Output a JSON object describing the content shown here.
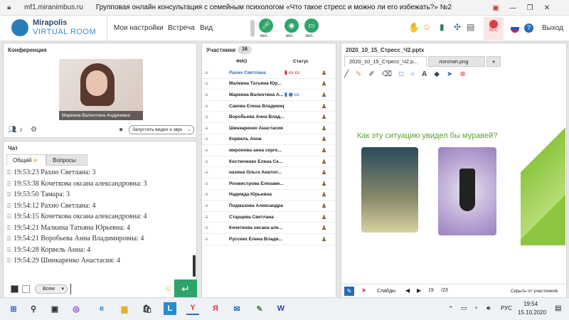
{
  "window": {
    "url": "mf1.miranimbus.ru",
    "title": "Групповая онлайн консультация с семейным психологом «Что такое стресс и можно ли его избежать?» №2"
  },
  "app": {
    "logo_line1": "Mirapolis",
    "logo_line2": "VIRTUAL ROOM",
    "menu": [
      "Мои настройки",
      "Встреча",
      "Вид"
    ],
    "mic_label": "вкл.",
    "cam_label": "вкл.",
    "screen_label": "вкл.",
    "rec_label": "REC",
    "exit_label": "Выход",
    "colors": {
      "accent": "#2da56a",
      "rec": "#e03a3a",
      "header_blue": "#2a7db8"
    }
  },
  "conference": {
    "title": "Конференция",
    "video_caption": "Маркина Валентина  Андреевна",
    "start_video_label": "Запустить видео и звук"
  },
  "chat": {
    "title": "Чат",
    "tabs": [
      "Общий",
      "Вопросы"
    ],
    "messages": [
      "19:53:23 Рахно Светлана: 3",
      "19:53:38 Кочеткова  оксана александровна: 3",
      "19:53:50 Тамара: 3",
      "19:54:12 Рахно Светлана: 4",
      "19:54:15 Кочеткова  оксана александровна: 4",
      "19:54:21 Малкина Татьяна  Юрьевна: 4",
      "19:54:21 Воробьева Анна  Владимировна: 4",
      "19:54:28 Корвель Анна: 4",
      "19:54:29 Шинкаренко  Анастасия: 4"
    ],
    "recipient": "Всем",
    "send_icon": "enter-icon"
  },
  "participants": {
    "title": "Участники",
    "count": "16",
    "col_name": "ФИО",
    "col_status": "Статус",
    "rows": [
      "Рахно Светлана",
      "Малкина Татьяна  Юр...",
      "Маркина Валентина  А...",
      "Сакова Елена Владимир...",
      "Воробьева Анна  Влад...",
      "Шинкаренко  Анастасия",
      "Корвель Анна",
      "миронова  анна  серге...",
      "Костюченко  Елена Се...",
      "назина  Ольга Анатол...",
      "Рохмистрова  Елизаве...",
      "Надежда  Юрьевна",
      "Подмазова Александра",
      "Старцева Светлана",
      "Кочеткова  оксана але...",
      "Русских Елена Влади..."
    ]
  },
  "presentation": {
    "file_title": "2020_10_15_Стресс_Ч2.pptx",
    "tabs": [
      "2020_10_15_Стресс_Ч2.p...",
      "логотип.png",
      "+"
    ],
    "slide_heading": "Как эту ситуацию увидел бы муравей?",
    "slides_label": "Слайды",
    "page_current": "19",
    "page_total": "/23",
    "hide_label": "Скрыть от участников"
  },
  "taskbar": {
    "language": "РУС",
    "time": "19:54",
    "date": "15.10.2020"
  }
}
